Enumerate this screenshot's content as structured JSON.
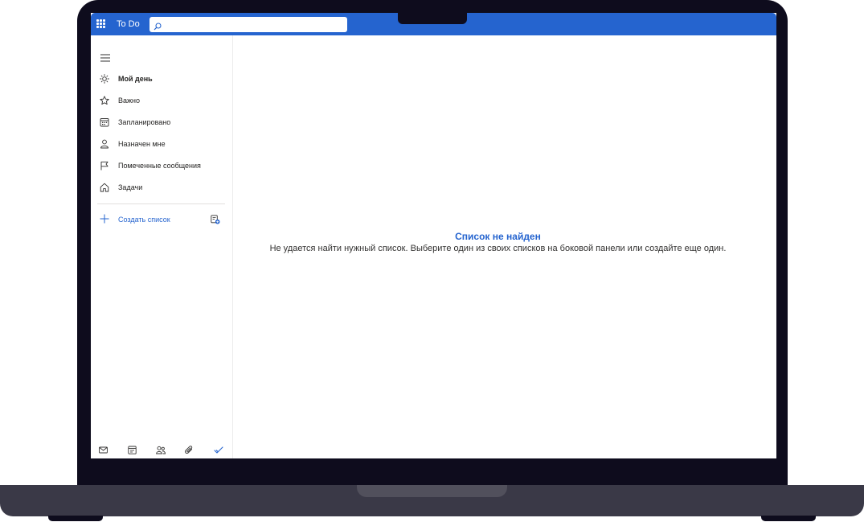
{
  "app": {
    "title": "To Do"
  },
  "search": {
    "placeholder": "",
    "value": ""
  },
  "sidebar": {
    "items": [
      {
        "label": "Мой день",
        "icon": "sun-icon",
        "active": true
      },
      {
        "label": "Важно",
        "icon": "star-icon"
      },
      {
        "label": "Запланировано",
        "icon": "calendar-icon"
      },
      {
        "label": "Назначен мне",
        "icon": "person-icon"
      },
      {
        "label": "Помеченные сообщения",
        "icon": "flag-icon"
      },
      {
        "label": "Задачи",
        "icon": "home-icon"
      }
    ],
    "new_list_label": "Создать список",
    "new_group_icon": "new-group-icon",
    "bottom_icons": [
      "mail-icon",
      "calendar-icon",
      "people-icon",
      "attachment-icon",
      "todo-check-icon"
    ]
  },
  "main": {
    "empty_title": "Список не найден",
    "empty_description": "Не удается найти нужный список. Выберите один из своих списков на боковой панели или создайте еще один."
  },
  "colors": {
    "accent": "#2564cf",
    "bezel": "#0e0c1d",
    "base": "#3a3947"
  }
}
